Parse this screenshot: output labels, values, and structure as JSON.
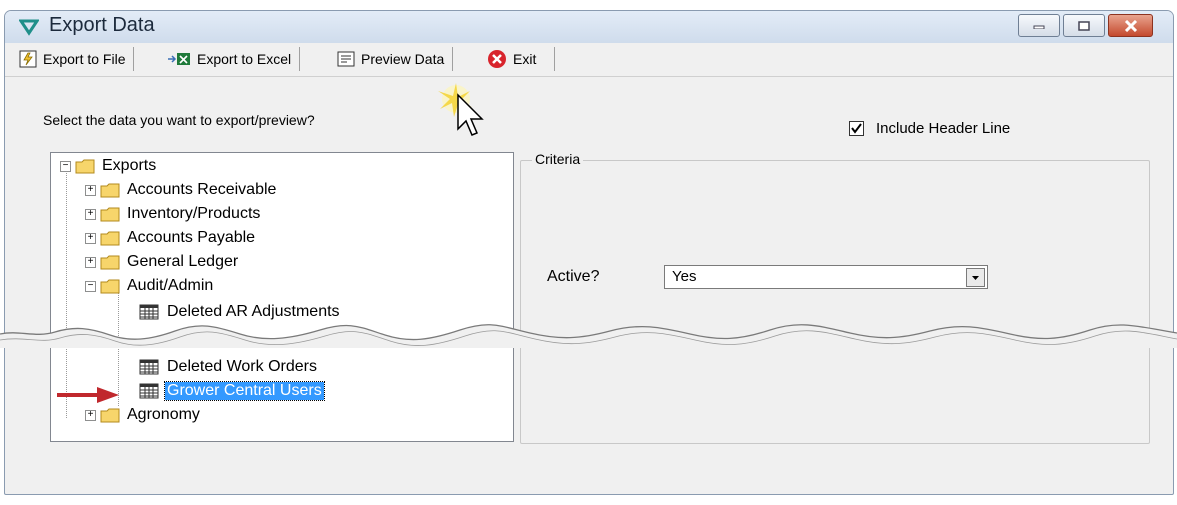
{
  "window": {
    "title": "Export Data"
  },
  "toolbar": {
    "export_file": "Export to File",
    "export_excel": "Export to Excel",
    "preview": "Preview Data",
    "exit": "Exit"
  },
  "prompt": "Select the data you want to export/preview?",
  "include_header": {
    "label": "Include Header Line",
    "checked": true
  },
  "tree": {
    "root": "Exports",
    "items": [
      "Accounts Receivable",
      "Inventory/Products",
      "Accounts Payable",
      "General Ledger",
      "Audit/Admin",
      "Deleted AR Adjustments",
      "Deleted Work Orders",
      "Grower Central Users",
      "Agronomy"
    ],
    "selected": "Grower Central Users"
  },
  "criteria": {
    "legend": "Criteria",
    "active_label": "Active?",
    "active_value": "Yes"
  },
  "colors": {
    "selection": "#3399ff",
    "annotation_arrow": "#c0282d"
  }
}
